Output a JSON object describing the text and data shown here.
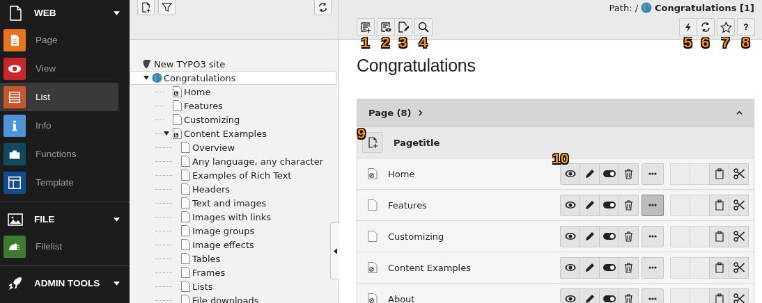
{
  "sidebar": {
    "groups": [
      {
        "label": "WEB",
        "kind": "web",
        "items": [
          {
            "label": "Page",
            "kind": "page",
            "color": "#e8731d",
            "selected": false
          },
          {
            "label": "View",
            "kind": "view",
            "color": "#c9262b",
            "selected": false
          },
          {
            "label": "List",
            "kind": "list",
            "color": "#c8552c",
            "selected": true
          },
          {
            "label": "Info",
            "kind": "info",
            "color": "#4f93d9",
            "selected": false
          },
          {
            "label": "Functions",
            "kind": "functions",
            "color": "#0f4a5e",
            "selected": false
          },
          {
            "label": "Template",
            "kind": "template",
            "color": "#144b8c",
            "selected": false
          }
        ]
      },
      {
        "label": "FILE",
        "kind": "file",
        "items": [
          {
            "label": "Filelist",
            "kind": "filelist",
            "color": "#3d7b2e",
            "selected": false
          }
        ]
      },
      {
        "label": "ADMIN TOOLS",
        "kind": "admin"
      }
    ]
  },
  "tree": {
    "toolbar": [
      {
        "kind": "new-page"
      },
      {
        "kind": "filter"
      },
      {
        "kind": "refresh"
      }
    ],
    "nodes": [
      {
        "label": "New TYPO3 site",
        "kind": "site",
        "children": [
          {
            "label": "Congratulations",
            "kind": "globe",
            "selected": true,
            "expanded": true,
            "children": [
              {
                "label": "Home",
                "kind": "shortcut",
                "selected": false
              },
              {
                "label": "Features",
                "kind": "page",
                "selected": false
              },
              {
                "label": "Customizing",
                "kind": "page",
                "selected": false
              },
              {
                "label": "Content Examples",
                "kind": "shortcut",
                "selected": false,
                "expanded": true,
                "children": [
                  {
                    "label": "Overview",
                    "kind": "page",
                    "selected": false
                  },
                  {
                    "label": "Any language, any character",
                    "kind": "page",
                    "selected": false
                  },
                  {
                    "label": "Examples of Rich Text",
                    "kind": "page",
                    "selected": false
                  },
                  {
                    "label": "Headers",
                    "kind": "page",
                    "selected": false
                  },
                  {
                    "label": "Text and images",
                    "kind": "page",
                    "selected": false
                  },
                  {
                    "label": "Images with links",
                    "kind": "page",
                    "selected": false
                  },
                  {
                    "label": "Image groups",
                    "kind": "page",
                    "selected": false
                  },
                  {
                    "label": "Image effects",
                    "kind": "page",
                    "selected": false
                  },
                  {
                    "label": "Tables",
                    "kind": "page",
                    "selected": false
                  },
                  {
                    "label": "Frames",
                    "kind": "page",
                    "selected": false
                  },
                  {
                    "label": "Lists",
                    "kind": "page",
                    "selected": false
                  },
                  {
                    "label": "File downloads",
                    "kind": "page",
                    "selected": false
                  }
                ]
              }
            ]
          }
        ]
      }
    ]
  },
  "main": {
    "path": {
      "label": "Path: /",
      "page": "Congratulations [1]"
    },
    "toolbar_left": [
      [
        {
          "kind": "new-record",
          "callout": "1"
        }
      ],
      [
        {
          "kind": "view",
          "callout": "2"
        },
        {
          "kind": "edit",
          "callout": "3"
        }
      ],
      [
        {
          "kind": "search",
          "callout": "4"
        }
      ]
    ],
    "toolbar_right": [
      [
        {
          "kind": "flash",
          "callout": "5"
        },
        {
          "kind": "refresh",
          "callout": "6"
        }
      ],
      [
        {
          "kind": "star",
          "callout": "7"
        }
      ],
      [
        {
          "kind": "help",
          "label": "?",
          "callout": "8"
        }
      ]
    ],
    "title": "Congratulations",
    "panel": {
      "title": "Page (8)",
      "expanded": true,
      "new_callout": "9",
      "column": "Pagetitle",
      "rows": [
        {
          "title": "Home",
          "kind": "shortcut",
          "more_selected": false,
          "callout": "10"
        },
        {
          "title": "Features",
          "kind": "page",
          "more_selected": true
        },
        {
          "title": "Customizing",
          "kind": "page",
          "more_selected": false
        },
        {
          "title": "Content Examples",
          "kind": "shortcut",
          "more_selected": false
        },
        {
          "title": "About",
          "kind": "shortcut",
          "more_selected": false
        }
      ]
    }
  }
}
